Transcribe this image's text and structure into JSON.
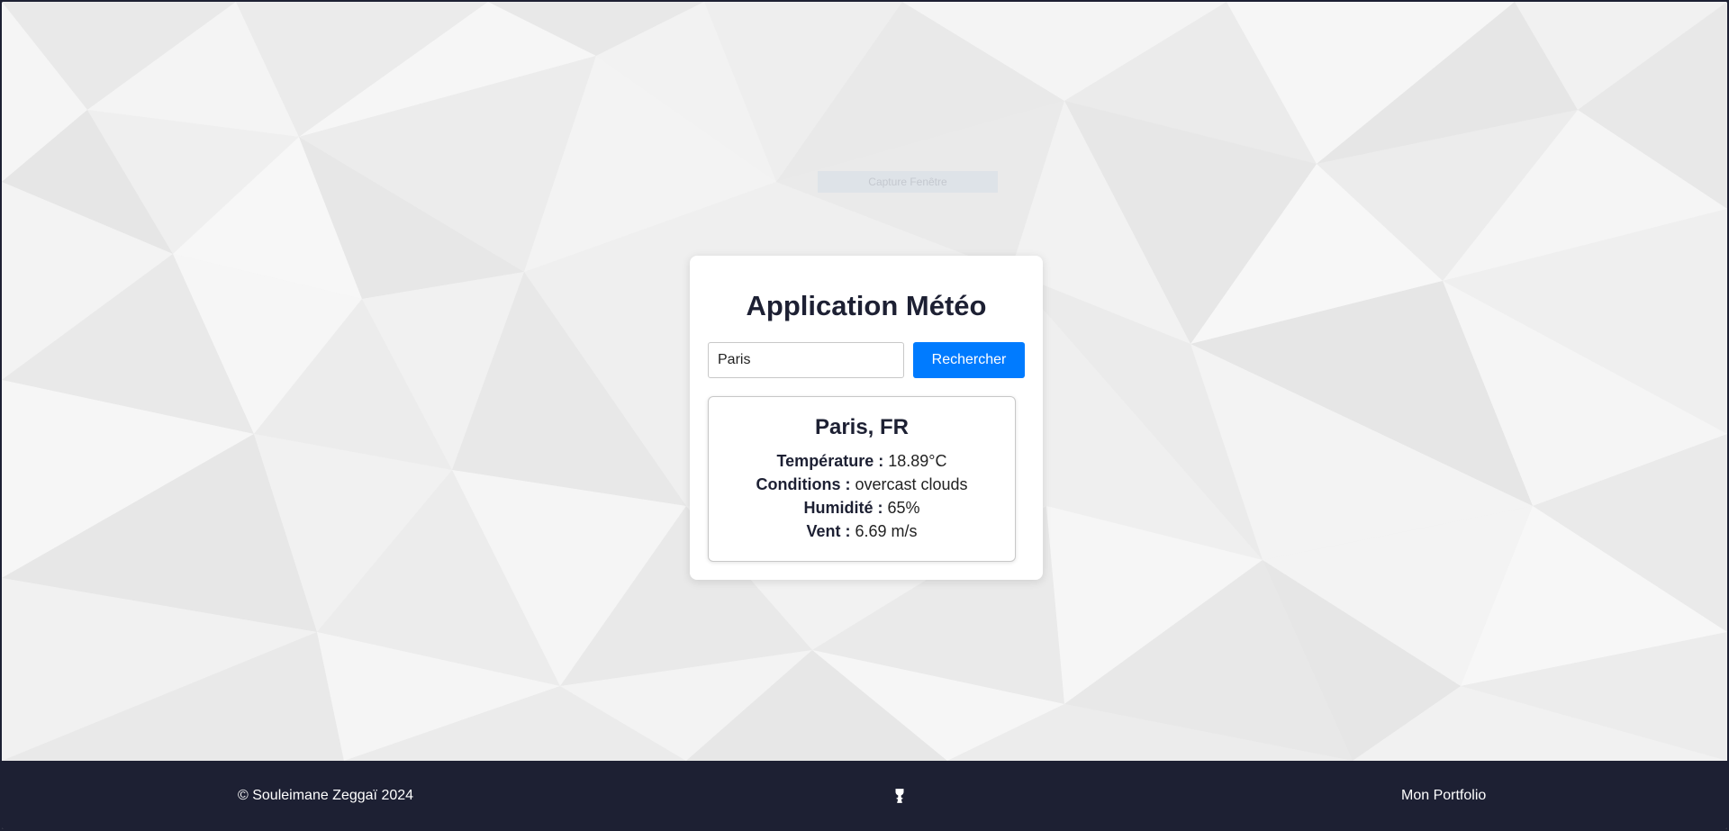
{
  "capture_overlay": {
    "label": "Capture Fenêtre"
  },
  "card": {
    "title": "Application Météo",
    "search": {
      "value": "Paris",
      "button_label": "Rechercher"
    }
  },
  "weather": {
    "location": "Paris, FR",
    "temperature_label": "Température :",
    "temperature_value": "18.89°C",
    "conditions_label": "Conditions :",
    "conditions_value": "overcast clouds",
    "humidity_label": "Humidité :",
    "humidity_value": "65%",
    "wind_label": "Vent :",
    "wind_value": "6.69 m/s"
  },
  "footer": {
    "copyright": "© Souleimane Zeggaï 2024",
    "icon": "github-icon",
    "portfolio_link": "Mon Portfolio"
  },
  "colors": {
    "primary": "#007bff",
    "dark": "#1d2033",
    "background": "#f0f0f0"
  }
}
